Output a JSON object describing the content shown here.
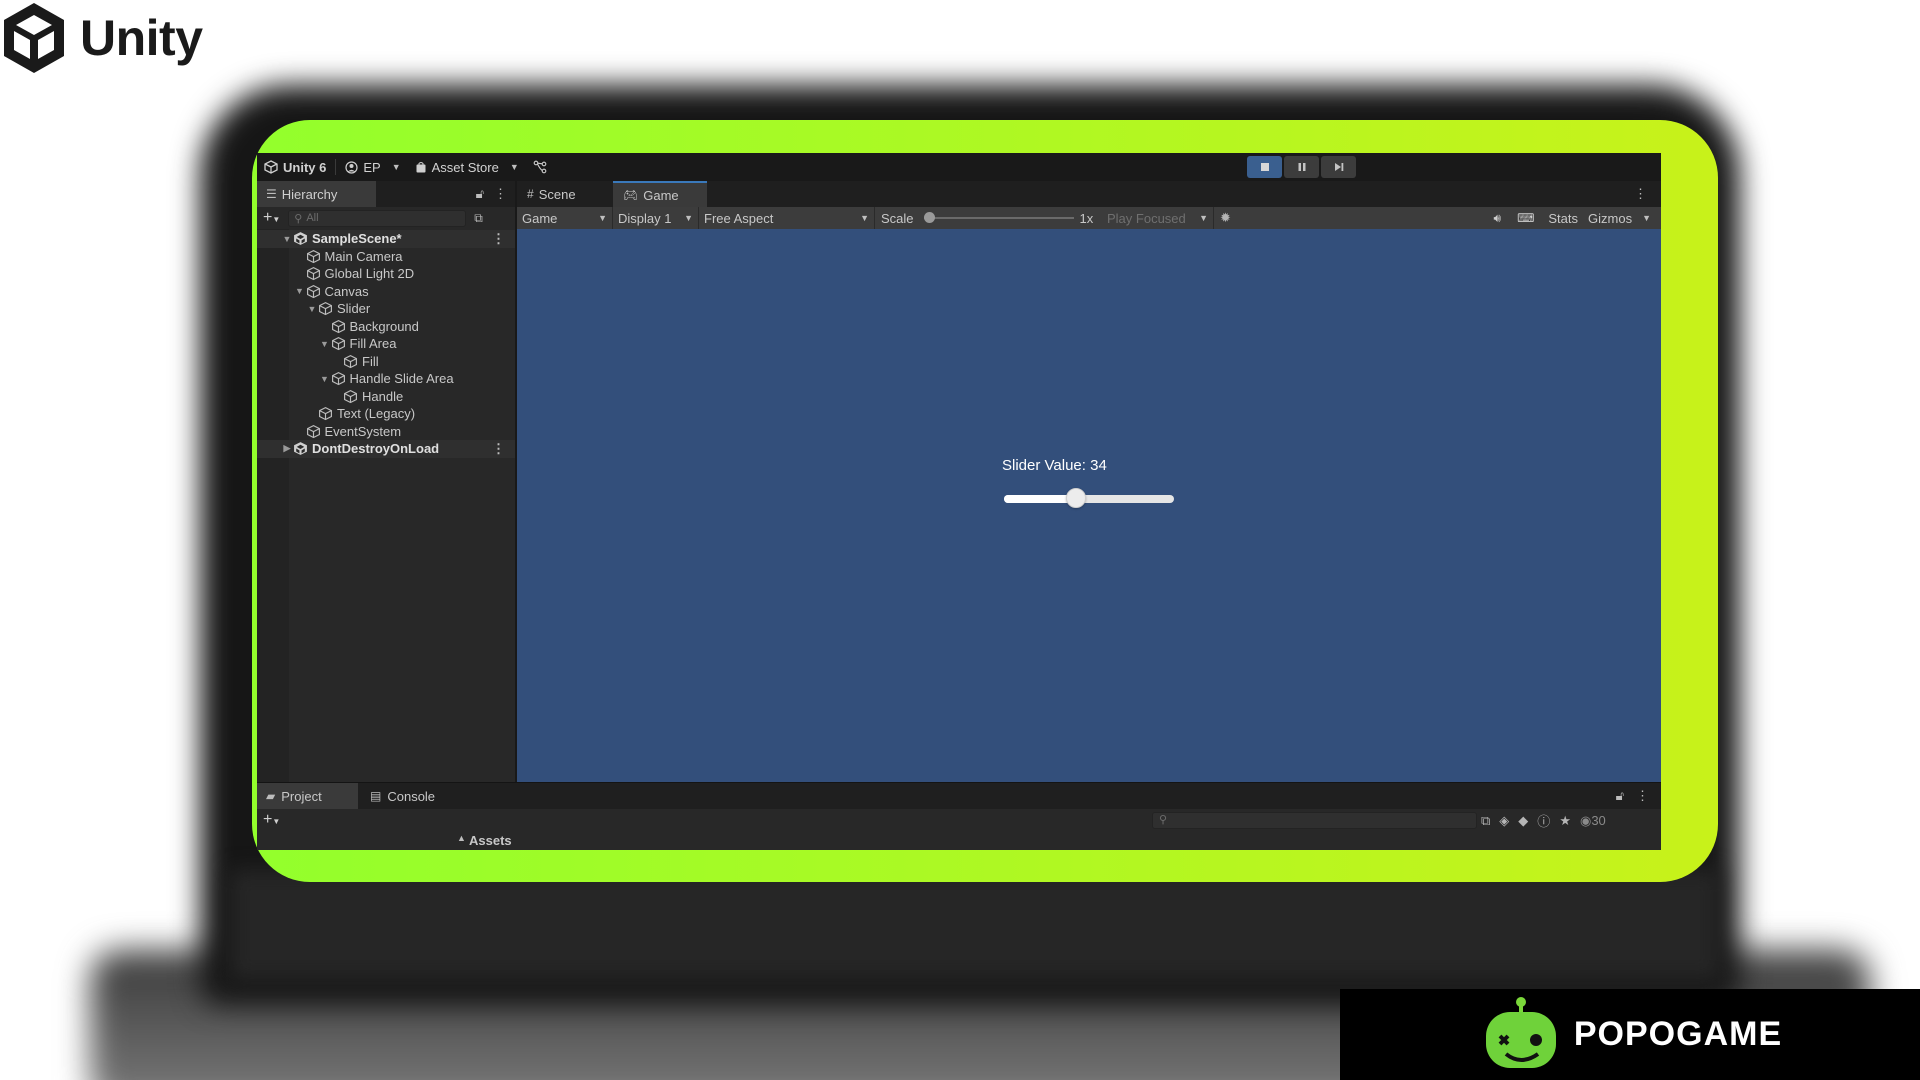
{
  "brand": {
    "name": "Unity"
  },
  "toolbar": {
    "app_label": "Unity 6",
    "account_label": "EP",
    "store_label": "Asset Store"
  },
  "hierarchy": {
    "tab_label": "Hierarchy",
    "search_placeholder": "All",
    "items": [
      {
        "label": "SampleScene*",
        "depth": 0,
        "expanded": true,
        "kind": "scene"
      },
      {
        "label": "Main Camera",
        "depth": 1,
        "kind": "object"
      },
      {
        "label": "Global Light 2D",
        "depth": 1,
        "kind": "object"
      },
      {
        "label": "Canvas",
        "depth": 1,
        "expanded": true,
        "kind": "object"
      },
      {
        "label": "Slider",
        "depth": 2,
        "expanded": true,
        "kind": "object"
      },
      {
        "label": "Background",
        "depth": 3,
        "kind": "object"
      },
      {
        "label": "Fill Area",
        "depth": 3,
        "expanded": true,
        "kind": "object"
      },
      {
        "label": "Fill",
        "depth": 4,
        "kind": "object"
      },
      {
        "label": "Handle Slide Area",
        "depth": 3,
        "expanded": true,
        "kind": "object"
      },
      {
        "label": "Handle",
        "depth": 4,
        "kind": "object"
      },
      {
        "label": "Text (Legacy)",
        "depth": 2,
        "kind": "object"
      },
      {
        "label": "EventSystem",
        "depth": 1,
        "kind": "object"
      },
      {
        "label": "DontDestroyOnLoad",
        "depth": 0,
        "expanded": false,
        "kind": "scene"
      }
    ]
  },
  "view_tabs": {
    "scene": "Scene",
    "game": "Game"
  },
  "game_controls": {
    "mode": "Game",
    "display": "Display 1",
    "aspect": "Free Aspect",
    "scale_label": "Scale",
    "scale_value": "1x",
    "play_focused": "Play Focused",
    "stats": "Stats",
    "gizmos": "Gizmos"
  },
  "game_ui": {
    "slider_text": "Slider Value: 34",
    "slider_fraction": 0.34
  },
  "bottom": {
    "project_tab": "Project",
    "console_tab": "Console",
    "assets_label": "Assets",
    "hidden_count": "30"
  },
  "banner": {
    "text": "POPOGAME"
  },
  "colors": {
    "frame_green": "#93ff2c",
    "game_bg": "#334f7b",
    "accent_blue": "#3a79bb"
  }
}
